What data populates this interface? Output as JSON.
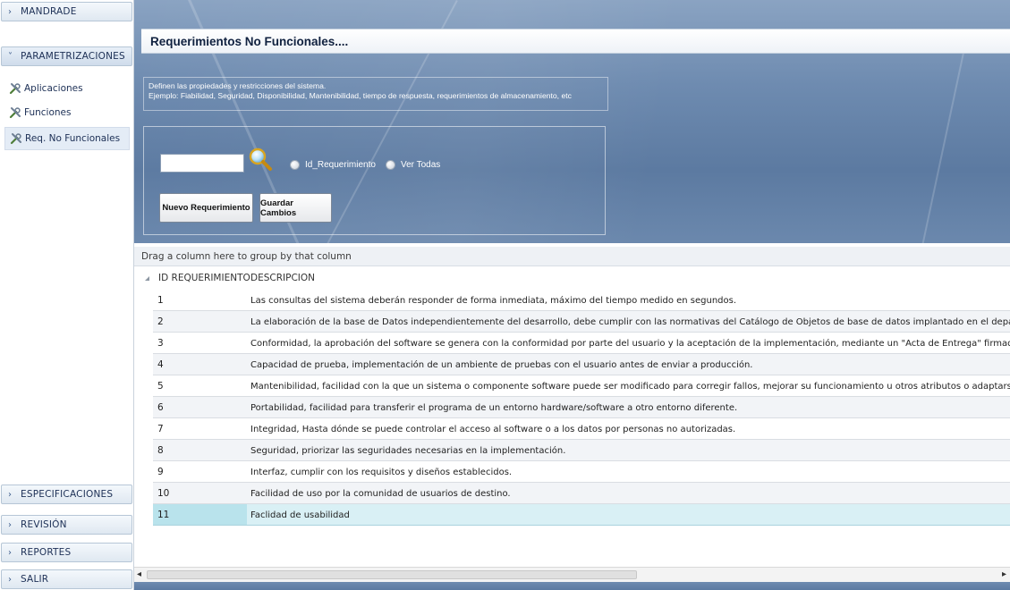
{
  "sidebar": {
    "sections_top": [
      {
        "label": "MANDRADE",
        "open": false
      },
      {
        "label": "PARAMETRIZACIONES",
        "open": true
      }
    ],
    "items": [
      {
        "label": "Aplicaciones",
        "icon": "wrench-icon"
      },
      {
        "label": "Funciones",
        "icon": "wrench-icon"
      },
      {
        "label": "Req. No Funcionales",
        "icon": "wrench-icon",
        "active": true
      }
    ],
    "sections_bottom": [
      {
        "label": "ESPECIFICACIONES"
      },
      {
        "label": "REVISIÓN"
      },
      {
        "label": "REPORTES"
      },
      {
        "label": "SALIR"
      }
    ]
  },
  "page": {
    "title": "Requerimientos No Funcionales....",
    "description_line1": "Definen las propiedades y restricciones del sistema.",
    "description_line2": "Ejemplo: Fiabilidad, Seguridad, Disponibilidad, Mantenibilidad, tiempo de respuesta, requerimientos de almacenamiento, etc"
  },
  "search": {
    "value": "",
    "radio_id_label": "Id_Requerimiento",
    "radio_all_label": "Ver Todas"
  },
  "buttons": {
    "new": "Nuevo Requerimiento",
    "save": "Guardar Cambios"
  },
  "grid": {
    "group_hint": "Drag a column here to group by that column",
    "columns": [
      "ID REQUERIMIENTO",
      "DESCRIPCION"
    ],
    "rows": [
      {
        "id": "1",
        "desc": "Las consultas del sistema deberán responder de forma inmediata, máximo del tiempo medido en segundos."
      },
      {
        "id": "2",
        "desc": "La elaboración de la base de Datos independientemente del desarrollo, debe cumplir con  las normativas del Catálogo de Objetos de base de datos implantado en el departamento de s"
      },
      {
        "id": "3",
        "desc": "Conformidad, la aprobación del software se genera con la conformidad por parte del usuario y la aceptación de la implementación, mediante un \"Acta de Entrega\" firmada por cada repr"
      },
      {
        "id": "4",
        "desc": "Capacidad de prueba, implementación de un ambiente de pruebas con el usuario antes de  enviar a producción."
      },
      {
        "id": "5",
        "desc": "Mantenibilidad,  facilidad con la que un sistema o componente software puede ser modificado para corregir fallos, mejorar su funcionamiento u otros atributos o adaptarse a cambios e"
      },
      {
        "id": "6",
        "desc": "Portabilidad, facilidad para transferir el programa de un entorno hardware/software a otro entorno diferente."
      },
      {
        "id": "7",
        "desc": "Integridad, Hasta dónde se puede controlar el acceso al software o a los datos por personas no autorizadas."
      },
      {
        "id": "8",
        "desc": "Seguridad, priorizar las seguridades necesarias en la implementación."
      },
      {
        "id": "9",
        "desc": "Interfaz, cumplir con los requisitos y diseños establecidos."
      },
      {
        "id": "10",
        "desc": "Facilidad de uso por la comunidad de usuarios de destino."
      },
      {
        "id": "11",
        "desc": "Faclidad  de usabilidad"
      }
    ],
    "selected_row": 11
  },
  "colors": {
    "banner": "#6e8bb0",
    "selected_row": "#d9f0f5",
    "sidebar_text": "#1c2f55"
  }
}
